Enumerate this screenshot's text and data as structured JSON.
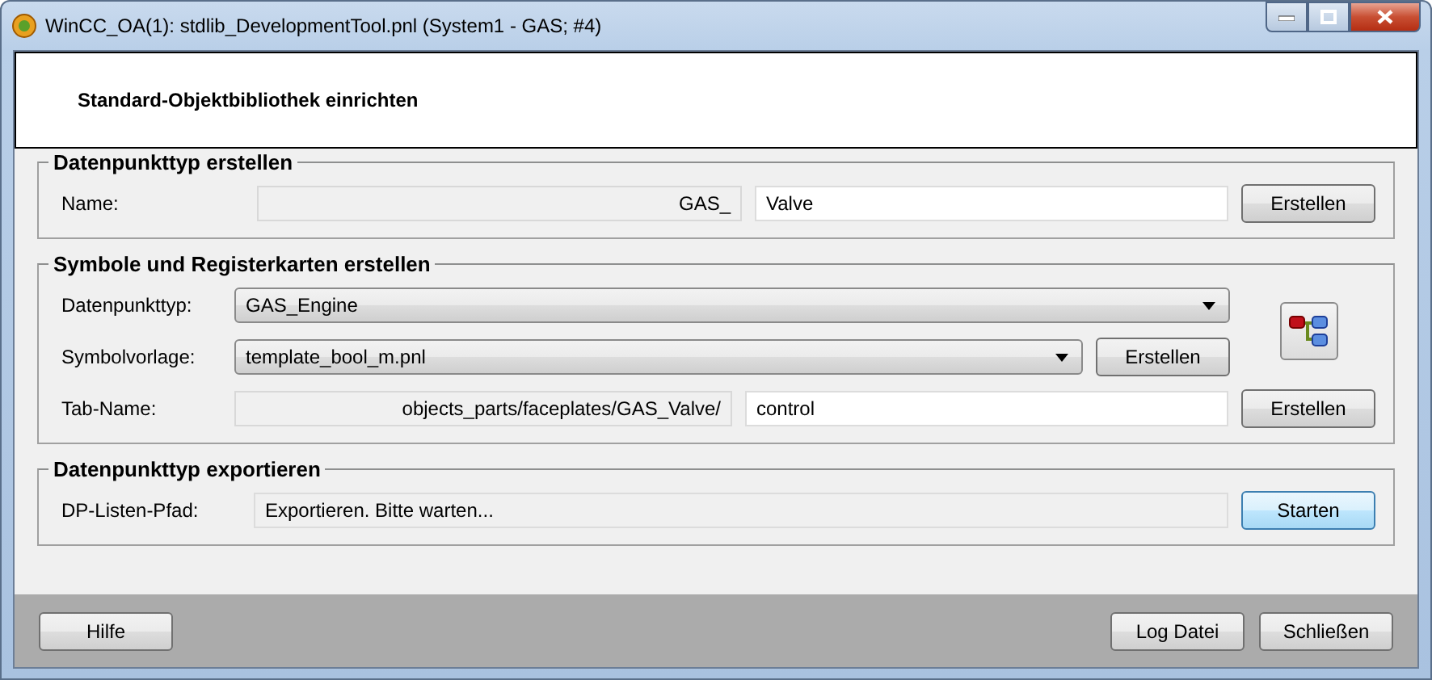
{
  "window": {
    "title": "WinCC_OA(1): stdlib_DevelopmentTool.pnl (System1 - GAS; #4)"
  },
  "header": {
    "title": "Standard-Objektbibliothek einrichten"
  },
  "groups": [
    {
      "title": "Datenpunkttyp erstellen",
      "kind": "form",
      "rows": [
        {
          "label": "Name:",
          "fields": [
            {
              "kind": "readonly",
              "value": "GAS_"
            },
            {
              "kind": "input",
              "value": "Valve"
            }
          ],
          "button": {
            "label": "Erstellen",
            "highlighted": false
          }
        }
      ]
    },
    {
      "title": "Symbole und Registerkarten erstellen",
      "kind": "form-with-tool",
      "rows": [
        {
          "label": "Datenpunkttyp:",
          "fields": [
            {
              "kind": "dropdown",
              "value": "GAS_Engine"
            }
          ]
        },
        {
          "label": "Symbolvorlage:",
          "fields": [
            {
              "kind": "dropdown",
              "value": "template_bool_m.pnl"
            }
          ],
          "button": {
            "label": "Erstellen",
            "highlighted": false
          }
        },
        {
          "label": "Tab-Name:",
          "fields": [
            {
              "kind": "readonly",
              "value": "objects_parts/faceplates/GAS_Valve/"
            },
            {
              "kind": "input",
              "value": "control"
            }
          ],
          "button": {
            "label": "Erstellen",
            "highlighted": false
          }
        }
      ]
    },
    {
      "title": "Datenpunkttyp exportieren",
      "kind": "form",
      "rows": [
        {
          "label": "DP-Listen-Pfad:",
          "fields": [
            {
              "kind": "status",
              "value": "Exportieren. Bitte warten..."
            }
          ],
          "button": {
            "label": "Starten",
            "highlighted": true
          }
        }
      ]
    }
  ],
  "footer": {
    "left_buttons": [
      "Hilfe"
    ],
    "right_buttons": [
      "Log Datei",
      "Schließen"
    ]
  }
}
